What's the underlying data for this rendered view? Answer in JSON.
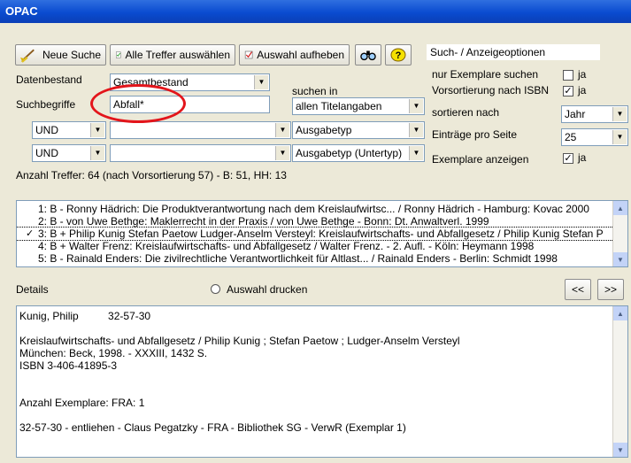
{
  "window": {
    "title": "OPAC"
  },
  "toolbar": {
    "new_search": "Neue Suche",
    "select_all": "Alle Treffer auswählen",
    "clear_selection": "Auswahl aufheben",
    "search_options_label": "Such- / Anzeigeoptionen"
  },
  "form": {
    "datenbestand_label": "Datenbestand",
    "datenbestand_value": "Gesamtbestand",
    "suchbegriffe_label": "Suchbegriffe",
    "suchbegriffe_value": "Abfall*",
    "suchen_in_label": "suchen in",
    "suchen_in_value": "allen Titelangaben",
    "row2_op": "UND",
    "row2_value": "",
    "row2_field": "Ausgabetyp",
    "row3_op": "UND",
    "row3_value": "",
    "row3_field": "Ausgabetyp (Untertyp)"
  },
  "options": {
    "nur_exemplare_label": "nur Exemplare suchen",
    "nur_exemplare_ja": "ja",
    "vorsortierung_label": "Vorsortierung nach ISBN",
    "vorsortierung_ja": "ja",
    "sortieren_label": "sortieren nach",
    "sortieren_value": "Jahr",
    "eintraege_label": "Einträge pro Seite",
    "eintraege_value": "25",
    "exemplare_anzeigen_label": "Exemplare anzeigen",
    "exemplare_anzeigen_ja": "ja"
  },
  "summary": "Anzahl Treffer: 64 (nach Vorsortierung 57) - B: 51, HH: 13",
  "results": [
    "1: B - Ronny Hädrich: Die Produktverantwortung nach dem Kreislaufwirtsc... / Ronny Hädrich - Hamburg: Kovac 2000",
    "2: B - von Uwe Bethge: Maklerrecht in der Praxis / von Uwe Bethge - Bonn: Dt. Anwaltverl. 1999",
    "3: B + Philip Kunig  Stefan Paetow  Ludger-Anselm Versteyl: Kreislaufwirtschafts- und Abfallgesetz / Philip Kunig  Stefan P",
    "4: B + Walter Frenz: Kreislaufwirtschafts- und Abfallgesetz / Walter Frenz. - 2. Aufl. - Köln: Heymann 1998",
    "5: B - Rainald Enders: Die zivilrechtliche Verantwortlichkeit für Altlast... / Rainald Enders - Berlin: Schmidt 1998"
  ],
  "selected_mark": "✓",
  "details_section": {
    "label": "Details",
    "print_label": "Auswahl drucken",
    "prev": "<<",
    "next": ">>"
  },
  "details_lines": [
    "Kunig, Philip          32-57-30",
    "",
    "Kreislaufwirtschafts- und Abfallgesetz / Philip Kunig ; Stefan Paetow ; Ludger-Anselm Versteyl",
    "München: Beck, 1998. - XXXIII, 1432 S.",
    "ISBN 3-406-41895-3",
    "",
    "",
    "Anzahl Exemplare:  FRA: 1",
    "",
    "32-57-30 - entliehen - Claus Pegatzky - FRA - Bibliothek SG - VerwR (Exemplar 1)"
  ],
  "colors": {
    "title_bar": "#0a4bd0",
    "highlight_circle": "#e3151b",
    "window_bg": "#ece9d8"
  }
}
